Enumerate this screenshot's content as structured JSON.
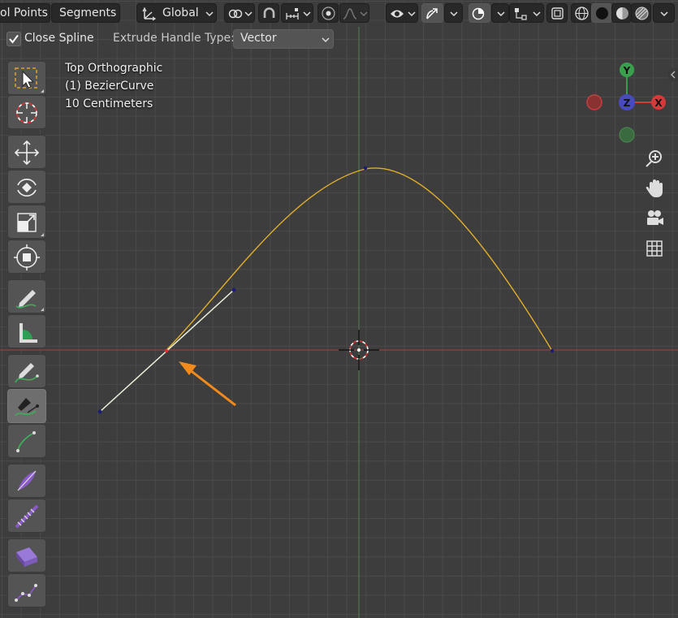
{
  "header": {
    "mode_tabs": [
      {
        "label": "ol Points"
      },
      {
        "label": "Segments"
      }
    ],
    "orientation": {
      "label": "Global",
      "icon": "transform-orientation-icon"
    },
    "pivot_icon": "pivot-icon",
    "snap_icon": "magnet-icon",
    "snap_target_icon": "snap-increment-icon",
    "proportional_icon": "proportional-edit-icon",
    "falloff_icon": "falloff-curve-icon",
    "visibility_icon": "eye-icon",
    "gizmo_icon": "gizmo-icon",
    "overlay_icon": "overlay-icon",
    "xray_icon": "xray-icon",
    "shading_icons": [
      "wireframe-icon",
      "solid-icon",
      "material-icon",
      "rendered-icon"
    ]
  },
  "tool_settings": {
    "close_spline_label": "Close Spline",
    "close_spline_checked": true,
    "extrude_handle_label": "Extrude Handle Type:",
    "extrude_handle_value": "Vector"
  },
  "viewport": {
    "view_name": "Top Orthographic",
    "object_name": "(1) BezierCurve",
    "grid_scale": "10 Centimeters"
  },
  "gizmo": {
    "axes": [
      "Y",
      "Z",
      "X"
    ]
  },
  "toolbar": {
    "tools": [
      {
        "name": "select-box-tool",
        "icon": "select-box-icon"
      },
      {
        "name": "cursor-tool",
        "icon": "cursor-icon"
      },
      {
        "name": "move-tool",
        "icon": "move-icon"
      },
      {
        "name": "rotate-tool",
        "icon": "rotate-icon"
      },
      {
        "name": "scale-tool",
        "icon": "scale-icon"
      },
      {
        "name": "transform-tool",
        "icon": "transform-icon"
      },
      {
        "name": "annotate-tool",
        "icon": "annotate-icon"
      },
      {
        "name": "measure-tool",
        "icon": "measure-icon"
      },
      {
        "name": "draw-tool",
        "icon": "curve-draw-icon"
      },
      {
        "name": "curve-pen-tool",
        "icon": "curve-pen-icon",
        "selected": true
      },
      {
        "name": "tilt-tool",
        "icon": "tilt-icon"
      },
      {
        "name": "radius-tool",
        "icon": "radius-icon"
      },
      {
        "name": "randomize-tool",
        "icon": "randomize-icon"
      },
      {
        "name": "extrude-tool",
        "icon": "extrude-icon"
      },
      {
        "name": "vertex-tool",
        "icon": "vertex-icon"
      }
    ]
  },
  "nav_icons": [
    "zoom-icon",
    "pan-hand-icon",
    "camera-icon",
    "grid-view-icon"
  ],
  "colors": {
    "curve": "#e8b325",
    "handle": "#e8f0d8",
    "x_axis": "#9c3a3a",
    "y_axis": "#5c7a5c",
    "arrow": "#f28a1c",
    "selected_tool": "#6e6e6e"
  }
}
